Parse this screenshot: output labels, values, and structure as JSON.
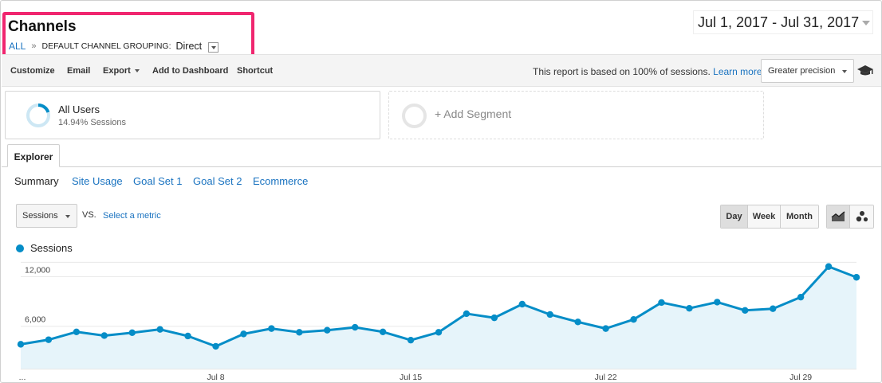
{
  "header": {
    "title": "Channels",
    "breadcrumb": {
      "all": "ALL",
      "separator": "»",
      "label": "DEFAULT CHANNEL GROUPING:",
      "value": "Direct"
    },
    "date_range": "Jul 1, 2017 - Jul 31, 2017"
  },
  "toolbar": {
    "customize": "Customize",
    "email": "Email",
    "export": "Export",
    "add_to_dashboard": "Add to Dashboard",
    "shortcut": "Shortcut",
    "info_text": "This report is based on 100% of sessions.",
    "learn_more": "Learn more",
    "precision": "Greater precision"
  },
  "segments": {
    "active": {
      "name": "All Users",
      "sub": "14.94% Sessions"
    },
    "add": "+ Add Segment"
  },
  "tabs": {
    "explorer": "Explorer"
  },
  "subtabs": [
    "Summary",
    "Site Usage",
    "Goal Set 1",
    "Goal Set 2",
    "Ecommerce"
  ],
  "controls": {
    "metric": "Sessions",
    "vs": "VS.",
    "select_metric": "Select a metric",
    "periods": [
      "Day",
      "Week",
      "Month"
    ]
  },
  "colors": {
    "accent": "#058dc7",
    "fill": "#e6f4fa",
    "highlight": "#f0266f",
    "link": "#1a73c0"
  },
  "chart_data": {
    "type": "area",
    "legend": "Sessions",
    "x": [
      "Jul 1",
      "Jul 2",
      "Jul 3",
      "Jul 4",
      "Jul 5",
      "Jul 6",
      "Jul 7",
      "Jul 8",
      "Jul 9",
      "Jul 10",
      "Jul 11",
      "Jul 12",
      "Jul 13",
      "Jul 14",
      "Jul 15",
      "Jul 16",
      "Jul 17",
      "Jul 18",
      "Jul 19",
      "Jul 20",
      "Jul 21",
      "Jul 22",
      "Jul 23",
      "Jul 24",
      "Jul 25",
      "Jul 26",
      "Jul 27",
      "Jul 28",
      "Jul 29",
      "Jul 30",
      "Jul 31"
    ],
    "series": [
      {
        "name": "Sessions",
        "values": [
          2950,
          3500,
          4450,
          4000,
          4350,
          4750,
          3950,
          2700,
          4200,
          4850,
          4400,
          4650,
          5000,
          4450,
          3450,
          4400,
          6650,
          6150,
          7800,
          6550,
          5650,
          4850,
          5950,
          8000,
          7300,
          8050,
          7050,
          7250,
          8650,
          12350,
          11050
        ]
      }
    ],
    "x_tick_labels": [
      "...",
      "Jul 8",
      "Jul 15",
      "Jul 22",
      "Jul 29"
    ],
    "y_tick_labels": [
      "6,000",
      "12,000"
    ],
    "ylim": [
      0,
      13000
    ],
    "grid": "horizontal"
  }
}
